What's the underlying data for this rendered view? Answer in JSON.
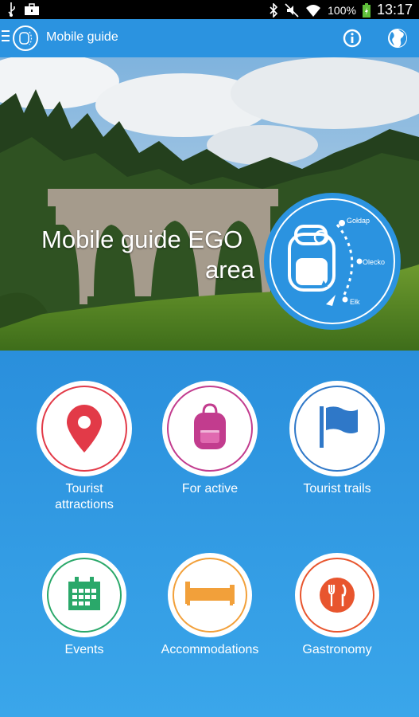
{
  "status_bar": {
    "battery": "100%",
    "time": "13:17"
  },
  "app_bar": {
    "title": "Mobile guide"
  },
  "hero": {
    "title_line1": "Mobile guide EGO",
    "title_line2": "area",
    "badge_places": [
      "Gołdap",
      "Olecko",
      "Ełk"
    ]
  },
  "tiles": [
    {
      "label_line1": "Tourist",
      "label_line2": "attractions",
      "icon": "map-pin-icon",
      "color": "#e23a48"
    },
    {
      "label_line1": "For active",
      "label_line2": "",
      "icon": "backpack-icon",
      "color": "#c23c8e"
    },
    {
      "label_line1": "Tourist trails",
      "label_line2": "",
      "icon": "flag-icon",
      "color": "#2f78c8"
    },
    {
      "label_line1": "Events",
      "label_line2": "",
      "icon": "calendar-icon",
      "color": "#2aa86a"
    },
    {
      "label_line1": "Accommodations",
      "label_line2": "",
      "icon": "bed-icon",
      "color": "#f2a03a"
    },
    {
      "label_line1": "Gastronomy",
      "label_line2": "",
      "icon": "cutlery-icon",
      "color": "#e8552e"
    }
  ]
}
